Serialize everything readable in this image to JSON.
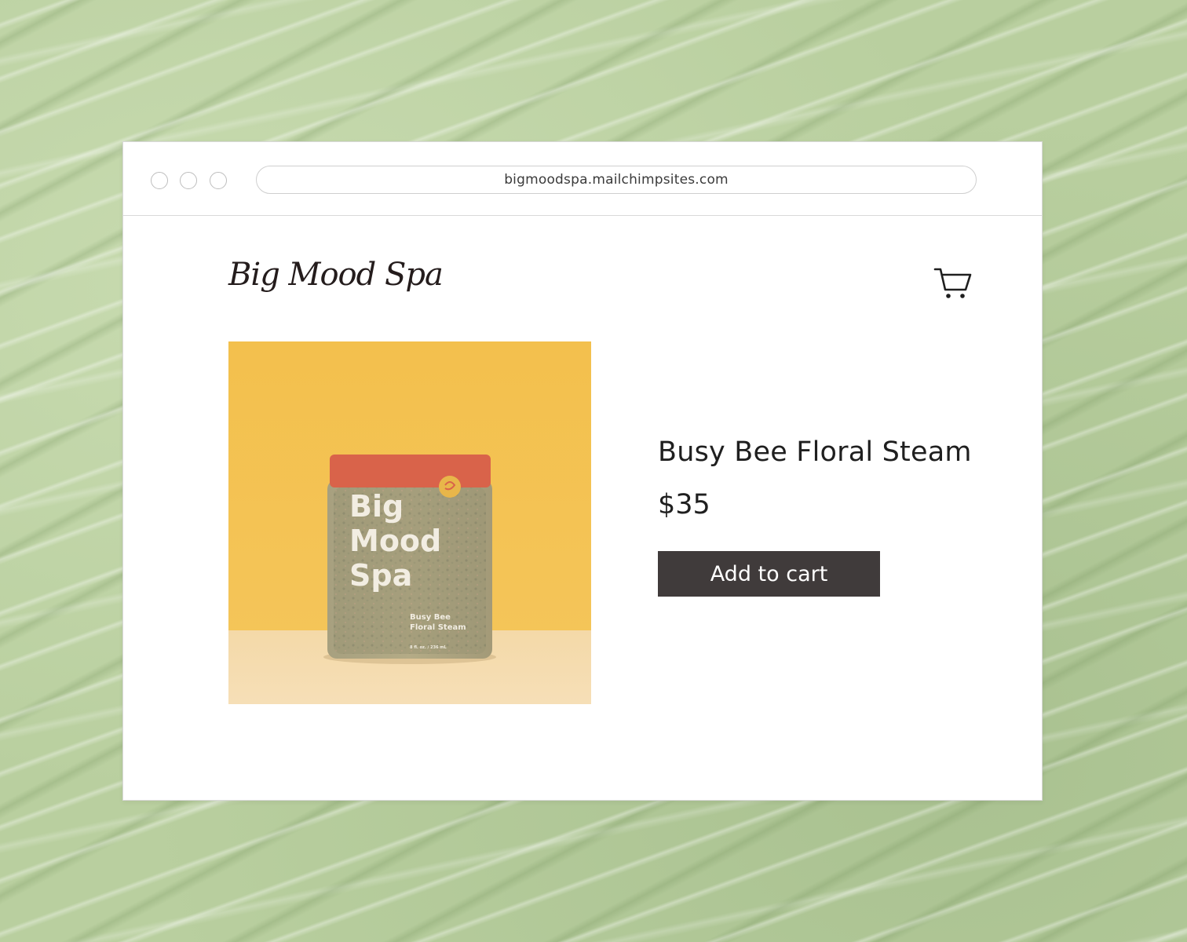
{
  "browser": {
    "url": "bigmoodspa.mailchimpsites.com"
  },
  "site": {
    "brand": "Big Mood Spa",
    "cart_icon": "shopping-cart-icon"
  },
  "product": {
    "title": "Busy Bee Floral Steam",
    "price": "$35",
    "add_to_cart_label": "Add to cart",
    "image": {
      "jar_brand_lines": [
        "Big",
        "Mood",
        "Spa"
      ],
      "jar_product_lines": [
        "Busy Bee",
        "Floral Steam"
      ],
      "jar_volume": "8 fl. oz. / 236 mL",
      "background_color": "#f2c14e",
      "lid_color": "#d9634a"
    }
  },
  "colors": {
    "button_bg": "#403b3b",
    "page_bg": "#b9cf9f"
  }
}
